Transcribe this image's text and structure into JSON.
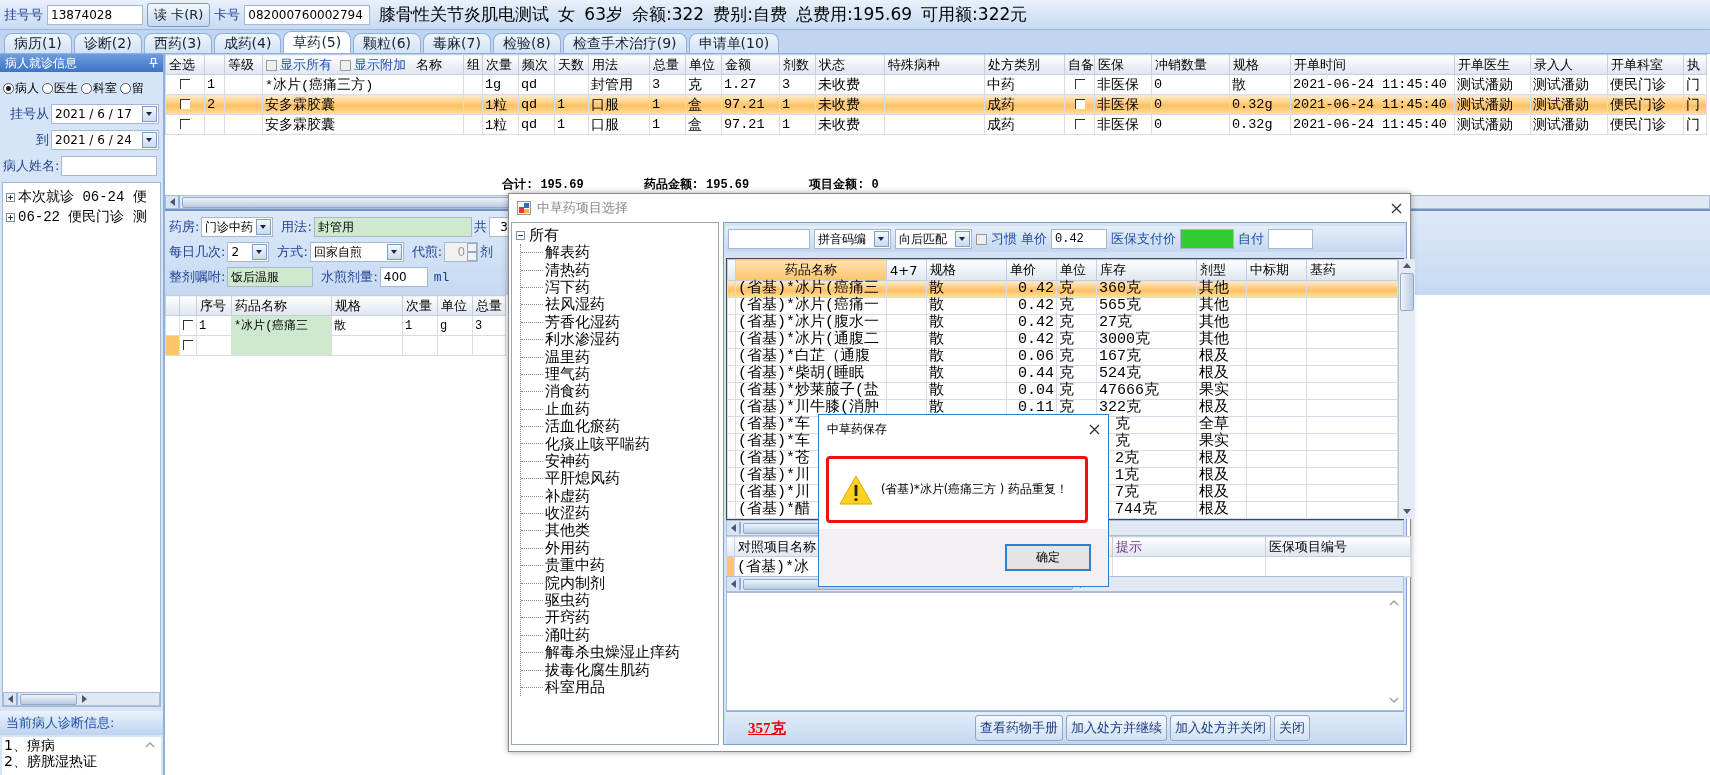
{
  "top_bar": {
    "reg_label": "挂号号",
    "reg_no": "13874028",
    "read_card_button": "读 卡(R)",
    "card_label": "卡号",
    "card_no": "082000760002794",
    "patient_info": [
      "膝骨性关节炎肌电测试",
      "女",
      "63岁",
      "余额:322",
      "费别:自费",
      "总费用:195.69",
      "可用额:322元"
    ]
  },
  "tabs": [
    {
      "label": "病历(1)",
      "selected": false
    },
    {
      "label": "诊断(2)",
      "selected": false
    },
    {
      "label": "西药(3)",
      "selected": false
    },
    {
      "label": "成药(4)",
      "selected": false
    },
    {
      "label": "草药(5)",
      "selected": true
    },
    {
      "label": "颗粒(6)",
      "selected": false
    },
    {
      "label": "毒麻(7)",
      "selected": false
    },
    {
      "label": "检验(8)",
      "selected": false
    },
    {
      "label": "检查手术治疗(9)",
      "selected": false
    },
    {
      "label": "申请单(10)",
      "selected": false
    }
  ],
  "left_panel": {
    "title": "病人就诊信息",
    "filter_options": [
      {
        "label": "病人",
        "selected": true
      },
      {
        "label": "医生",
        "selected": false
      },
      {
        "label": "科室",
        "selected": false
      },
      {
        "label": "留",
        "selected": false
      }
    ],
    "date_from": {
      "label": "挂号从",
      "value": "2021 / 6 / 17"
    },
    "date_to": {
      "label": "到",
      "value": "2021 / 6 / 24"
    },
    "name_field": {
      "label": "病人姓名:"
    },
    "visits": [
      {
        "text": "本次就诊 06-24 便",
        "expanded": false
      },
      {
        "text": "06-22 便民门诊 测",
        "expanded": false
      }
    ],
    "diagnosis_title": "当前病人诊断信息:",
    "diagnoses": [
      "1、痹病",
      "2、膀胱湿热证"
    ]
  },
  "prescription_table": {
    "show_all": {
      "label": "显示所有",
      "checked": false
    },
    "show_extra": {
      "label": "显示附加",
      "checked": false
    },
    "columns": [
      {
        "label": "全选"
      },
      {},
      {
        "label": "等级"
      },
      {
        "label": "名称",
        "kind": "names"
      },
      {
        "label": "组"
      },
      {
        "label": "次量"
      },
      {
        "label": "频次"
      },
      {
        "label": "天数"
      },
      {
        "label": "用法"
      },
      {
        "label": "总量"
      },
      {
        "label": "单位"
      },
      {
        "label": "金额"
      },
      {
        "label": "剂数"
      },
      {
        "label": "状态"
      },
      {
        "label": "特殊病种"
      },
      {
        "label": "处方类别"
      },
      {
        "label": "自备"
      },
      {
        "label": "医保"
      },
      {
        "label": "冲销数量"
      },
      {
        "label": "规格"
      },
      {
        "label": "开单时间"
      },
      {
        "label": "开单医生"
      },
      {
        "label": "录入人"
      },
      {
        "label": "开单科室"
      },
      {
        "label": "执"
      }
    ],
    "rows": [
      {
        "selected": false,
        "cells": [
          {
            "checked": false
          },
          "1",
          null,
          "*冰片(癌痛三方)",
          null,
          "1g",
          "qd",
          null,
          "封管用",
          "3",
          "克",
          "1.27",
          "3",
          "未收费",
          null,
          "中药",
          {
            "checked": false
          },
          "非医保",
          "0",
          "散",
          "2021-06-24 11:45:40",
          "测试潘勋",
          "测试潘勋",
          "便民门诊",
          "门"
        ]
      },
      {
        "selected": true,
        "cells": [
          {
            "checked": false
          },
          "2",
          null,
          "安多霖胶囊",
          null,
          "1粒",
          "qd",
          "1",
          "口服",
          "1",
          "盒",
          "97.21",
          "1",
          "未收费",
          null,
          "成药",
          {
            "checked": false
          },
          "非医保",
          "0",
          "0.32g",
          "2021-06-24 11:45:40",
          "测试潘勋",
          "测试潘勋",
          "便民门诊",
          "门"
        ]
      },
      {
        "selected": false,
        "cells": [
          {
            "checked": false
          },
          null,
          null,
          "安多霖胶囊",
          null,
          "1粒",
          "qd",
          "1",
          "口服",
          "1",
          "盒",
          "97.21",
          "1",
          "未收费",
          null,
          "成药",
          {
            "checked": false
          },
          "非医保",
          "0",
          "0.32g",
          "2021-06-24 11:45:40",
          "测试潘勋",
          "测试潘勋",
          "便民门诊",
          "门"
        ]
      }
    ]
  },
  "totals": [
    "合计: 195.69",
    "药品金额: 195.69",
    "项目金额: 0"
  ],
  "herb_form": {
    "pharmacy": {
      "label": "药房:",
      "value": "门诊中药"
    },
    "usage": {
      "label": "用法:",
      "value": "封管用"
    },
    "total_doses": {
      "label": "共",
      "value": "3"
    },
    "times_per_day": {
      "label": "每日几次:",
      "value": "2"
    },
    "method": {
      "label": "方式:",
      "value": "回家自煎"
    },
    "proxy_decoct": {
      "label": "代煎:",
      "value": "0",
      "disabled": true
    },
    "dose_unit": "剂",
    "instruction": {
      "label": "整剂嘱咐:",
      "value": "饭后温服"
    },
    "water_volume": {
      "label": "水煎剂量:",
      "value": "400",
      "unit": "ml"
    }
  },
  "herb_table": {
    "columns": [
      "序号",
      "药品名称",
      "规格",
      "次量",
      "单位",
      "总量"
    ],
    "rows": [
      {
        "editing": false,
        "checked": false,
        "cells": [
          "1",
          "*冰片(癌痛三",
          "散",
          "1",
          "g",
          "3"
        ]
      },
      {
        "editing": true,
        "checked": false,
        "cells": [
          null,
          null,
          null,
          null,
          null,
          null
        ]
      }
    ]
  },
  "picker_dialog": {
    "title": "中草药项目选择",
    "categories": {
      "label": "所有",
      "expanded": true,
      "children": [
        {
          "label": "解表药"
        },
        {
          "label": "清热药"
        },
        {
          "label": "泻下药"
        },
        {
          "label": "祛风湿药"
        },
        {
          "label": "芳香化湿药"
        },
        {
          "label": "利水渗湿药"
        },
        {
          "label": "温里药"
        },
        {
          "label": "理气药"
        },
        {
          "label": "消食药"
        },
        {
          "label": "止血药"
        },
        {
          "label": "活血化瘀药"
        },
        {
          "label": "化痰止咳平喘药"
        },
        {
          "label": "安神药"
        },
        {
          "label": "平肝熄风药"
        },
        {
          "label": "补虚药"
        },
        {
          "label": "收涩药"
        },
        {
          "label": "其他类"
        },
        {
          "label": "外用药"
        },
        {
          "label": "贵重中药"
        },
        {
          "label": "院内制剂"
        },
        {
          "label": "驱虫药"
        },
        {
          "label": "开窍药"
        },
        {
          "label": "涌吐药"
        },
        {
          "label": "解毒杀虫燥湿止痒药"
        },
        {
          "label": "拔毒化腐生肌药"
        },
        {
          "label": "科室用品"
        }
      ]
    },
    "search": {
      "code_type": "拼音码编",
      "match_mode": "向后匹配",
      "habit": {
        "label": "习惯",
        "checked": false
      },
      "price_label": "单价",
      "price": "0.42",
      "insurance_price_label": "医保支付价",
      "self_pay_label": "自付"
    },
    "drug_table": {
      "columns": [
        {
          "label": "药品名称",
          "selected": true
        },
        {
          "label": "4+7",
          "selected": false
        },
        {
          "label": "规格",
          "selected": false
        },
        {
          "label": "单价",
          "selected": false
        },
        {
          "label": "单位",
          "selected": false
        },
        {
          "label": "库存",
          "selected": false
        },
        {
          "label": "剂型",
          "selected": false
        },
        {
          "label": "中标期",
          "selected": false
        },
        {
          "label": "基药",
          "selected": false
        }
      ],
      "rows": [
        {
          "selected": true,
          "covered": false,
          "cells": [
            "(省基)*冰片(癌痛三",
            null,
            "散",
            "0.42",
            "克",
            "360克",
            "其他",
            null,
            null
          ]
        },
        {
          "selected": false,
          "covered": false,
          "cells": [
            "(省基)*冰片(癌痛一",
            null,
            "散",
            "0.42",
            "克",
            "565克",
            "其他",
            null,
            null
          ]
        },
        {
          "selected": false,
          "covered": false,
          "cells": [
            "(省基)*冰片(腹水一",
            null,
            "散",
            "0.42",
            "克",
            "27克",
            "其他",
            null,
            null
          ]
        },
        {
          "selected": false,
          "covered": false,
          "cells": [
            "(省基)*冰片(通腹二",
            null,
            "散",
            "0.42",
            "克",
            "3000克",
            "其他",
            null,
            null
          ]
        },
        {
          "selected": false,
          "covered": false,
          "cells": [
            "(省基)*白芷（通腹",
            null,
            "散",
            "0.06",
            "克",
            "167克",
            "根及",
            null,
            null
          ]
        },
        {
          "selected": false,
          "covered": false,
          "cells": [
            "(省基)*柴胡(睡眠",
            null,
            "散",
            "0.44",
            "克",
            "524克",
            "根及",
            null,
            null
          ]
        },
        {
          "selected": false,
          "covered": false,
          "cells": [
            "(省基)*炒莱菔子(盐",
            null,
            "散",
            "0.04",
            "克",
            "47666克",
            "果实",
            null,
            null
          ]
        },
        {
          "selected": false,
          "covered": false,
          "cells": [
            "(省基)*川牛膝(消肿",
            null,
            "散",
            "0.11",
            "克",
            "322克",
            "根及",
            null,
            null
          ]
        },
        {
          "selected": false,
          "covered": true,
          "cells": [
            "(省基)*车",
            null,
            null,
            null,
            null,
            "克",
            "全草",
            null,
            null
          ]
        },
        {
          "selected": false,
          "covered": true,
          "cells": [
            "(省基)*车",
            null,
            null,
            null,
            null,
            "克",
            "果实",
            null,
            null
          ]
        },
        {
          "selected": false,
          "covered": true,
          "cells": [
            "(省基)*苍",
            null,
            null,
            null,
            null,
            "2克",
            "根及",
            null,
            null
          ]
        },
        {
          "selected": false,
          "covered": true,
          "cells": [
            "(省基)*川",
            null,
            null,
            null,
            null,
            "1克",
            "根及",
            null,
            null
          ]
        },
        {
          "selected": false,
          "covered": true,
          "cells": [
            "(省基)*川",
            null,
            null,
            null,
            null,
            "7克",
            "根及",
            null,
            null
          ]
        },
        {
          "selected": false,
          "covered": true,
          "cells": [
            "(省基)*醋",
            null,
            null,
            null,
            null,
            "744克",
            "根及",
            null,
            null
          ]
        }
      ]
    },
    "mapping_table": {
      "columns": [
        "对照项目名称",
        "提示",
        "医保项目编号"
      ],
      "rows": [
        {
          "selected": true,
          "cells": [
            "(省基)*冰",
            null,
            null
          ]
        }
      ]
    },
    "stock_total": "357克",
    "buttons": [
      "查看药物手册",
      "加入处方并继续",
      "加入处方并关闭",
      "关闭"
    ]
  },
  "message_box": {
    "title": "中草药保存",
    "message": "(省基)*冰片(癌痛三方 ) 药品重复！",
    "ok_button": "确定"
  }
}
